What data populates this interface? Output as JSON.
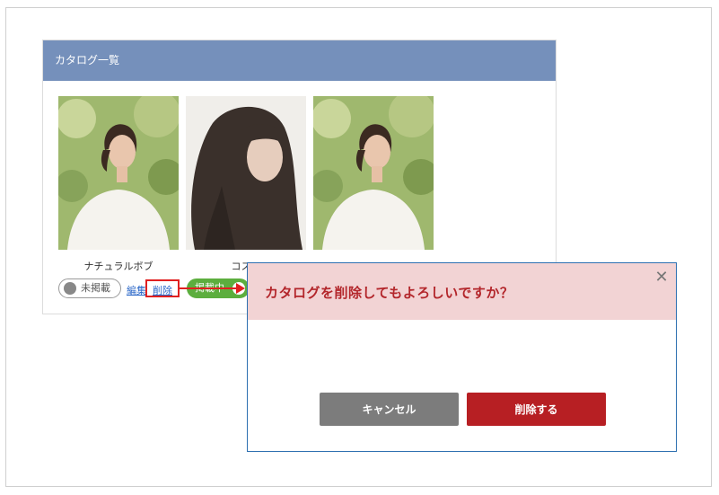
{
  "panel": {
    "title": "カタログ一覧"
  },
  "cards": [
    {
      "name": "ナチュラルボブ",
      "status": "未掲載",
      "edit": "編集",
      "delete": "削除"
    },
    {
      "name": "コスメ",
      "status": "掲載中"
    },
    {
      "name": ""
    }
  ],
  "dialog": {
    "title": "カタログを削除してもよろしいですか？",
    "close_icon": "close-icon",
    "cancel_label": "キャンセル",
    "delete_label": "削除する"
  },
  "colors": {
    "panel_header": "#7590bb",
    "dialog_header": "#f2d3d4",
    "dialog_title": "#b3262b",
    "delete_button": "#b71f23",
    "cancel_button": "#7c7c7c",
    "status_on": "#5cae3e",
    "annotation": "#e02020"
  }
}
